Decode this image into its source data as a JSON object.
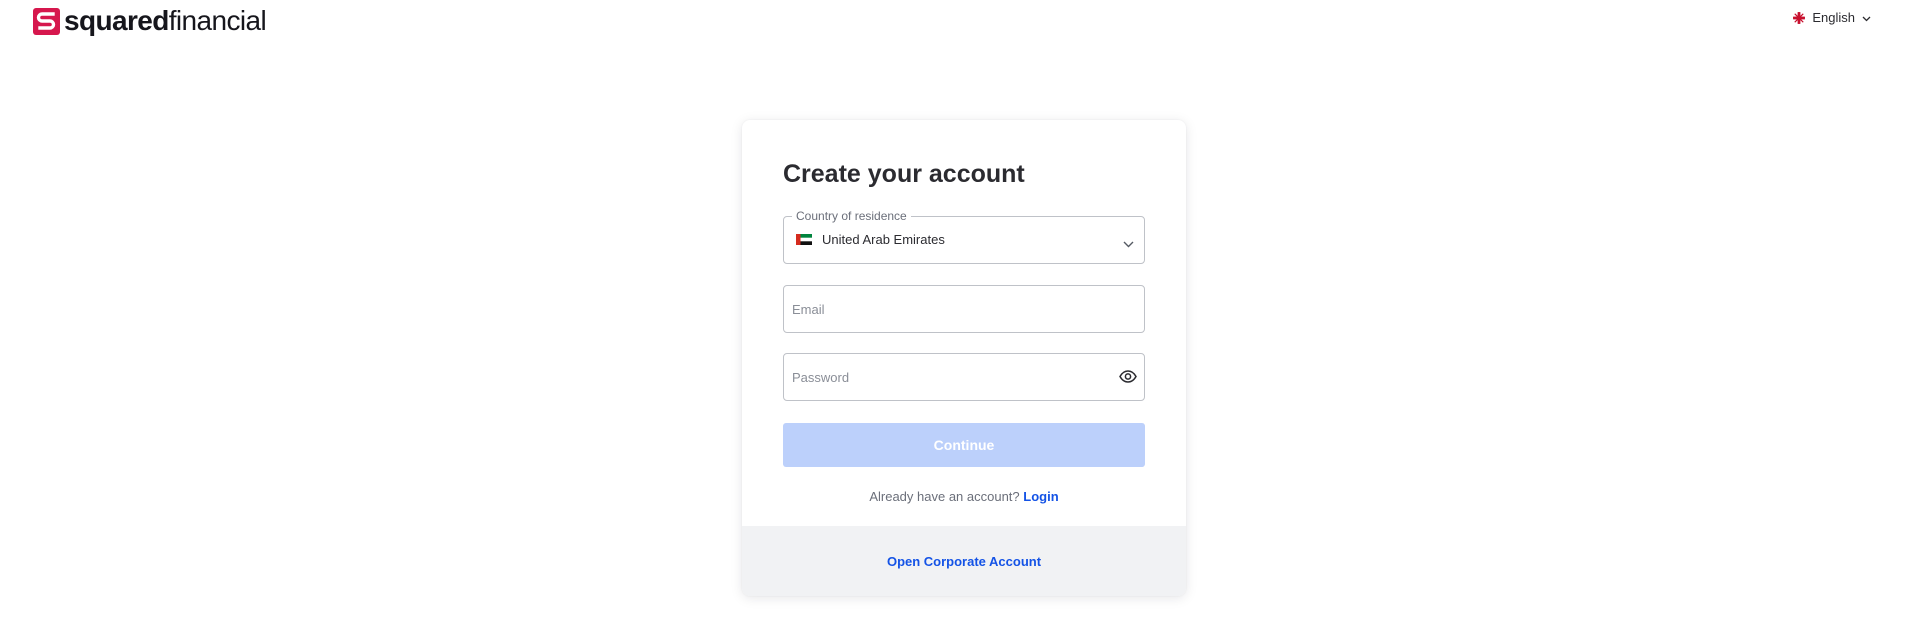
{
  "brand": {
    "name_bold": "squared",
    "name_light": "financial",
    "accent_color": "#d6174d"
  },
  "language": {
    "selected": "English",
    "flag_icon": "uk-flag-icon",
    "chevron_icon": "chevron-down-icon"
  },
  "form": {
    "title": "Create your account",
    "country": {
      "label": "Country of residence",
      "value": "United Arab Emirates",
      "flag_icon": "uae-flag-icon"
    },
    "email": {
      "placeholder": "Email",
      "value": ""
    },
    "password": {
      "placeholder": "Password",
      "value": "",
      "toggle_icon": "eye-icon"
    },
    "continue_label": "Continue",
    "continue_color": "#bcd0fb",
    "login_prompt": "Already have an account?",
    "login_label": "Login",
    "link_color": "#1453e6"
  },
  "footer": {
    "corporate_label": "Open Corporate Account"
  }
}
